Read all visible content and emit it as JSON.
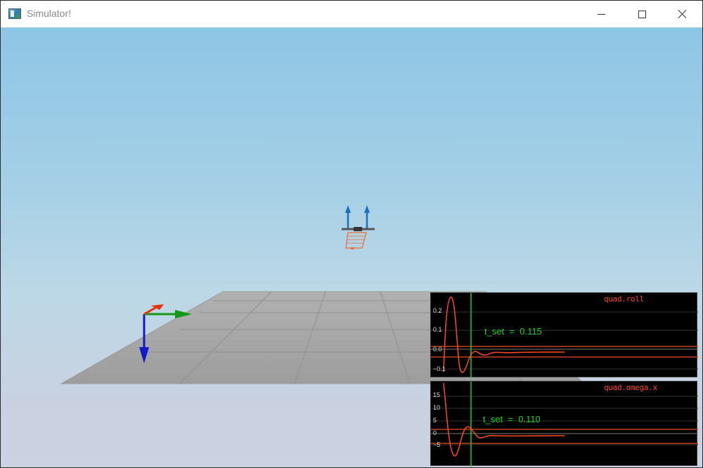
{
  "window": {
    "title": "Simulator!",
    "icon": "app-window-icon",
    "controls": {
      "minimize": "minimize-icon",
      "maximize": "maximize-icon",
      "close": "close-icon"
    }
  },
  "scene": {
    "sky_color_top": "#8ec6e5",
    "sky_color_bottom": "#cbd2e2",
    "ground_color": "#a7a7a7",
    "axis_colors": {
      "x": "#139813",
      "y": "#e8300e",
      "z": "#1319c8"
    },
    "quad_color": "#f06a2a",
    "thrust_arrow_color": "#1a6fc0"
  },
  "plots": [
    {
      "title": "quad.roll",
      "annotation": "t_set  =  0.115",
      "y_ticks": [
        "0.2",
        "0.1",
        "0.0",
        "−0.1"
      ],
      "series_color": "#ff4a1c",
      "marker_color": "#19d219"
    },
    {
      "title": "quad.omega.x",
      "annotation": "t_set  =  0.110",
      "y_ticks": [
        "15",
        "10",
        "5",
        "0",
        "−5"
      ],
      "series_color": "#ff4a1c",
      "marker_color": "#19d219"
    }
  ]
}
